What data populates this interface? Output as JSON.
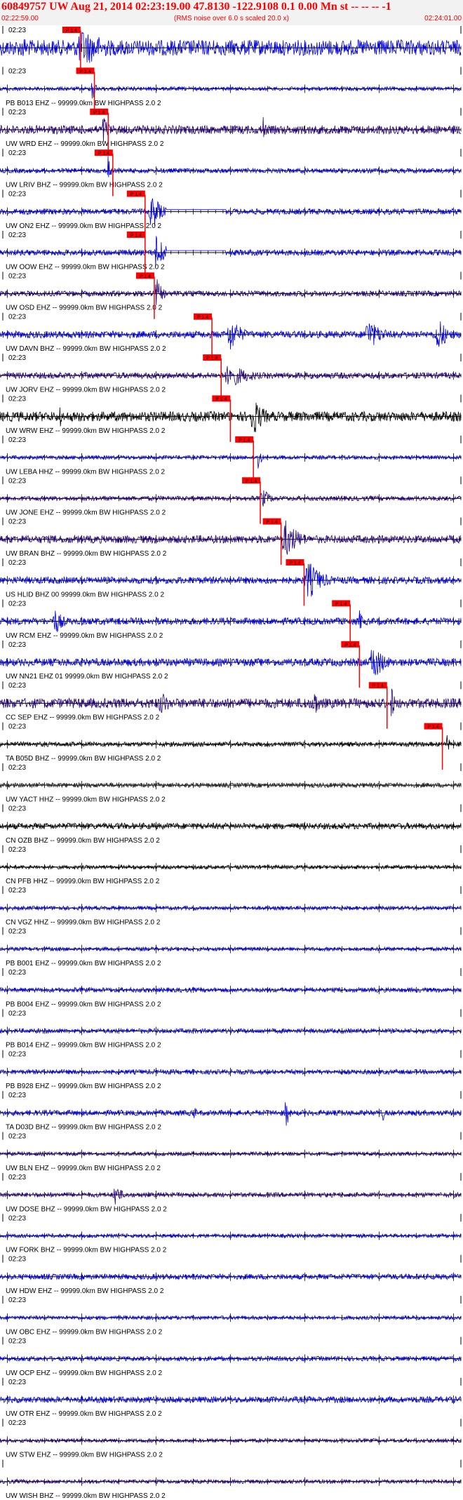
{
  "header": {
    "title": "60849757 UW Aug 21, 2014 02:23:19.00   47.8130 -122.9108  0.1 0.00 Mn st -- -- --  -1",
    "start_time": "02:22:59.00",
    "end_time": "02:24:01.00",
    "noise_note": "(RMS noise over 6.0 s scaled 20.0 x)"
  },
  "chart_data": {
    "type": "line",
    "title": "60849757 UW Aug 21, 2014 02:23:19.00   47.8130 -122.9108  0.1 0.00 Mn st -- -- --  -1",
    "x_range": [
      "02:22:59.00",
      "02:24:01.00"
    ],
    "traces": [
      {
        "label": "",
        "time": "02:23",
        "color": "#0000dd",
        "amp": 0.4,
        "bursts": [
          [
            0.18,
            0.1,
            1.0
          ],
          [
            0.05,
            0.05,
            0.6
          ]
        ],
        "pick_label": "P 1.4",
        "pick_x": 0.155
      },
      {
        "label": "PB B013 EHZ -- 99999.0km BW  HIGHPASS  2.0  2",
        "time": "02:23",
        "color": "#0000dd",
        "amp": 0.1,
        "bursts": [
          [
            0.2,
            0.01,
            1.0
          ]
        ],
        "pick_label": "P 1.4",
        "pick_x": 0.185
      },
      {
        "label": "UW WRD EHZ -- 99999.0km BW  HIGHPASS  2.0  2",
        "time": "02:23",
        "color": "#220077",
        "amp": 0.22,
        "bursts": [
          [
            0.225,
            0.02,
            0.8
          ],
          [
            0.57,
            0.01,
            0.9
          ]
        ],
        "pick_label": "P 1.4",
        "pick_x": 0.215
      },
      {
        "label": "UW LRIV BHZ -- 99999.0km BW  HIGHPASS  2.0  2",
        "time": "02:23",
        "color": "#0000dd",
        "amp": 0.12,
        "bursts": [
          [
            0.235,
            0.01,
            1.0
          ]
        ],
        "pick_label": "P 1.4",
        "pick_x": 0.225
      },
      {
        "label": "UW ON2 EHZ -- 99999.0km BW  HIGHPASS  2.0  2",
        "time": "02:23",
        "color": "#0000dd",
        "amp": 0.15,
        "bursts": [
          [
            0.33,
            0.03,
            1.0
          ]
        ],
        "pick_label": "P 1.4",
        "pick_x": 0.295,
        "flat": [
          0.36,
          0.49
        ]
      },
      {
        "label": "UW OOW EHZ -- 99999.0km BW  HIGHPASS  2.0  2",
        "time": "02:23",
        "color": "#0000dd",
        "amp": 0.15,
        "bursts": [
          [
            0.34,
            0.03,
            1.0
          ]
        ],
        "pick_label": "P 1.4",
        "pick_x": 0.295,
        "flat": [
          0.36,
          0.49
        ]
      },
      {
        "label": "UW OSD EHZ -- 99999.0km BW  HIGHPASS  2.0  2",
        "time": "02:23",
        "color": "#220077",
        "amp": 0.14,
        "bursts": [
          [
            0.34,
            0.02,
            0.8
          ]
        ],
        "pick_label": "P 1.4",
        "pick_x": 0.315
      },
      {
        "label": "UW DAVN BHZ -- 99999.0km BW  HIGHPASS  2.0  2",
        "time": "02:23",
        "color": "#0000dd",
        "amp": 0.18,
        "bursts": [
          [
            0.5,
            0.04,
            0.9
          ],
          [
            0.8,
            0.05,
            0.8
          ],
          [
            0.95,
            0.03,
            1.0
          ]
        ],
        "pick_label": "P 1.4",
        "pick_x": 0.44
      },
      {
        "label": "UW JORV EHZ -- 99999.0km BW  HIGHPASS  2.0  2",
        "time": "02:23",
        "color": "#220077",
        "amp": 0.16,
        "bursts": [
          [
            0.5,
            0.08,
            0.6
          ]
        ],
        "pick_label": "P 1.4",
        "pick_x": 0.46
      },
      {
        "label": "UW WRW EHZ -- 99999.0km BW  HIGHPASS  2.0  2",
        "time": "02:23",
        "color": "#000000",
        "amp": 0.25,
        "bursts": [
          [
            0.55,
            0.04,
            1.0
          ],
          [
            0.13,
            0.005,
            0.8
          ]
        ],
        "pick_label": "P 1.4",
        "pick_x": 0.48
      },
      {
        "label": "UW LEBA HHZ -- 99999.0km BW  HIGHPASS  2.0  2",
        "time": "02:23",
        "color": "#0000dd",
        "amp": 0.1,
        "bursts": [
          [
            0.56,
            0.01,
            0.8
          ]
        ],
        "pick_label": "P 1.4",
        "pick_x": 0.53
      },
      {
        "label": "UW JONE EHZ -- 99999.0km BW  HIGHPASS  2.0  2",
        "time": "02:23",
        "color": "#220077",
        "amp": 0.12,
        "bursts": [
          [
            0.57,
            0.03,
            0.5
          ]
        ],
        "pick_label": "P 1.4",
        "pick_x": 0.545
      },
      {
        "label": "UW BRAN BHZ -- 99999.0km BW  HIGHPASS  2.0  2",
        "time": "02:23",
        "color": "#220077",
        "amp": 0.2,
        "bursts": [
          [
            0.62,
            0.05,
            1.0
          ]
        ],
        "pick_label": "P 1.4",
        "pick_x": 0.59
      },
      {
        "label": "US HLID BHZ 00 99999.0km BW  HIGHPASS  2.0  2",
        "time": "02:23",
        "color": "#0000dd",
        "amp": 0.18,
        "bursts": [
          [
            0.67,
            0.05,
            1.0
          ]
        ],
        "pick_label": "P 1.4",
        "pick_x": 0.64
      },
      {
        "label": "UW RCM EHZ -- 99999.0km BW  HIGHPASS  2.0  2",
        "time": "02:23",
        "color": "#0000dd",
        "amp": 0.18,
        "bursts": [
          [
            0.12,
            0.03,
            0.7
          ],
          [
            0.78,
            0.01,
            0.7
          ]
        ],
        "pick_label": "P 1.4",
        "pick_x": 0.74
      },
      {
        "label": "UW NN21 EHZ 01 99999.0km BW  HIGHPASS  2.0  2",
        "time": "02:23",
        "color": "#0000dd",
        "amp": 0.2,
        "bursts": [
          [
            0.81,
            0.04,
            1.0
          ]
        ],
        "pick_label": "P 1.4",
        "pick_x": 0.76
      },
      {
        "label": "CC SEP EHZ -- 99999.0km BW  HIGHPASS  2.0  2",
        "time": "02:23",
        "color": "#220077",
        "amp": 0.25,
        "bursts": [
          [
            0.35,
            0.03,
            0.7
          ],
          [
            0.68,
            0.02,
            0.9
          ],
          [
            0.85,
            0.01,
            1.0
          ]
        ],
        "pick_label": "P 1.4",
        "pick_x": 0.82
      },
      {
        "label": "TA B05D BHZ -- 99999.0km BW  HIGHPASS  2.0  2",
        "time": "02:23",
        "color": "#000000",
        "amp": 0.12,
        "bursts": [
          [
            0.97,
            0.005,
            1.0
          ]
        ],
        "pick_label": "P 1.4",
        "pick_x": 0.94
      },
      {
        "label": "UW YACT HHZ -- 99999.0km BW  HIGHPASS  2.0  2",
        "time": "02:23",
        "color": "#222222",
        "amp": 0.12,
        "bursts": []
      },
      {
        "label": "CN OZB BHZ -- 99999.0km BW  HIGHPASS  2.0  2",
        "time": "02:23",
        "color": "#000000",
        "amp": 0.16,
        "bursts": []
      },
      {
        "label": "CN PFB HHZ -- 99999.0km BW  HIGHPASS  2.0  2",
        "time": "02:23",
        "color": "#000000",
        "amp": 0.1,
        "bursts": []
      },
      {
        "label": "CN VGZ HHZ -- 99999.0km BW  HIGHPASS  2.0  2",
        "time": "02:23",
        "color": "#0000dd",
        "amp": 0.1,
        "bursts": []
      },
      {
        "label": "PB B001 EHZ -- 99999.0km BW  HIGHPASS  2.0  2",
        "time": "02:23",
        "color": "#0000dd",
        "amp": 0.1,
        "bursts": []
      },
      {
        "label": "PB B004 EHZ -- 99999.0km BW  HIGHPASS  2.0  2",
        "time": "02:23",
        "color": "#0000dd",
        "amp": 0.12,
        "bursts": []
      },
      {
        "label": "PB B014 EHZ -- 99999.0km BW  HIGHPASS  2.0  2",
        "time": "02:23",
        "color": "#0000dd",
        "amp": 0.12,
        "bursts": []
      },
      {
        "label": "PB B928 EHZ -- 99999.0km BW  HIGHPASS  2.0  2",
        "time": "02:23",
        "color": "#0000dd",
        "amp": 0.12,
        "bursts": []
      },
      {
        "label": "TA D03D BHZ -- 99999.0km BW  HIGHPASS  2.0  2",
        "time": "02:23",
        "color": "#0000dd",
        "amp": 0.14,
        "bursts": [
          [
            0.42,
            0.01,
            0.5
          ],
          [
            0.62,
            0.01,
            1.0
          ],
          [
            0.83,
            0.005,
            0.8
          ]
        ]
      },
      {
        "label": "UW BLN EHZ -- 99999.0km BW  HIGHPASS  2.0  2",
        "time": "02:23",
        "color": "#220077",
        "amp": 0.1,
        "bursts": []
      },
      {
        "label": "UW DOSE BHZ -- 99999.0km BW  HIGHPASS  2.0  2",
        "time": "02:23",
        "color": "#220077",
        "amp": 0.12,
        "bursts": [
          [
            0.25,
            0.02,
            0.7
          ]
        ]
      },
      {
        "label": "UW FORK BHZ -- 99999.0km BW  HIGHPASS  2.0  2",
        "time": "02:23",
        "color": "#0000dd",
        "amp": 0.1,
        "bursts": []
      },
      {
        "label": "UW HDW EHZ -- 99999.0km BW  HIGHPASS  2.0  2",
        "time": "02:23",
        "color": "#0000dd",
        "amp": 0.14,
        "bursts": []
      },
      {
        "label": "UW OBC EHZ -- 99999.0km BW  HIGHPASS  2.0  2",
        "time": "02:23",
        "color": "#0000dd",
        "amp": 0.1,
        "bursts": []
      },
      {
        "label": "UW OCP EHZ -- 99999.0km BW  HIGHPASS  2.0  2",
        "time": "02:23",
        "color": "#0000dd",
        "amp": 0.12,
        "bursts": []
      },
      {
        "label": "UW OTR EHZ -- 99999.0km BW  HIGHPASS  2.0  2",
        "time": "02:23",
        "color": "#0000dd",
        "amp": 0.16,
        "bursts": []
      },
      {
        "label": "UW STW EHZ -- 99999.0km BW  HIGHPASS  2.0  2",
        "time": "02:23",
        "color": "#220077",
        "amp": 0.1,
        "bursts": []
      },
      {
        "label": "UW WISH BHZ -- 99999.0km BW  HIGHPASS  2.0  2",
        "time": "",
        "color": "#220077",
        "amp": 0.1,
        "bursts": []
      }
    ]
  },
  "colors": {
    "title": "#ff0000",
    "pick": "#ff0000",
    "trace_blue": "#0000dd",
    "trace_navy": "#220077",
    "trace_black": "#000000"
  }
}
